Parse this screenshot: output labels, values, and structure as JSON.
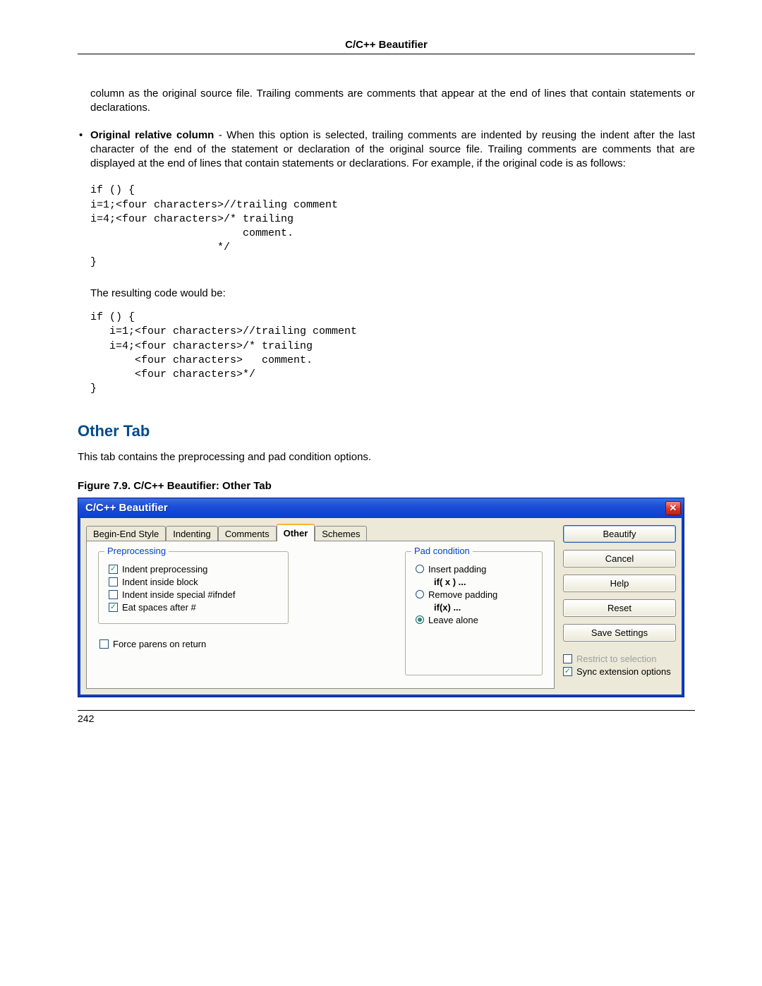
{
  "header": "C/C++ Beautifier",
  "para1": "column as the original source file. Trailing comments are comments that appear at the end of lines that contain statements or declarations.",
  "bullet_bold": "Original relative column",
  "bullet_rest": " - When this option is selected, trailing comments are indented by reusing the indent after the last character of the end of the statement or declaration of the original source file. Trailing comments are comments that are displayed at the end of lines that contain statements or declarations. For example, if the original code is as follows:",
  "code1": "if () {\ni=1;<four characters>//trailing comment\ni=4;<four characters>/* trailing\n                        comment.\n                    */\n}",
  "resulting_label": "The resulting code would be:",
  "code2": "if () {\n   i=1;<four characters>//trailing comment\n   i=4;<four characters>/* trailing\n       <four characters>   comment.\n       <four characters>*/\n}",
  "section_heading": "Other Tab",
  "section_text": "This tab contains the preprocessing and pad condition options.",
  "figure_caption": "Figure 7.9.  C/C++ Beautifier: Other Tab",
  "dialog": {
    "title": "C/C++ Beautifier",
    "tabs": [
      "Begin-End Style",
      "Indenting",
      "Comments",
      "Other",
      "Schemes"
    ],
    "active_tab": "Other",
    "preprocessing": {
      "title": "Preprocessing",
      "items": [
        {
          "label": "Indent preprocessing",
          "checked": true
        },
        {
          "label": "Indent inside block",
          "checked": false
        },
        {
          "label": "Indent inside special #ifndef",
          "checked": false
        },
        {
          "label": "Eat spaces after #",
          "checked": true
        }
      ]
    },
    "force_parens": {
      "label": "Force parens on return",
      "checked": false
    },
    "pad": {
      "title": "Pad condition",
      "options": [
        {
          "label": "Insert padding",
          "example": "if( x ) ...",
          "selected": false
        },
        {
          "label": "Remove padding",
          "example": "if(x) ...",
          "selected": false
        },
        {
          "label": "Leave alone",
          "example": "",
          "selected": true
        }
      ]
    },
    "buttons": [
      "Beautify",
      "Cancel",
      "Help",
      "Reset",
      "Save Settings"
    ],
    "restrict": {
      "label": "Restrict to selection",
      "checked": false,
      "disabled": true
    },
    "sync": {
      "label": "Sync extension options",
      "checked": true
    }
  },
  "page_number": "242"
}
